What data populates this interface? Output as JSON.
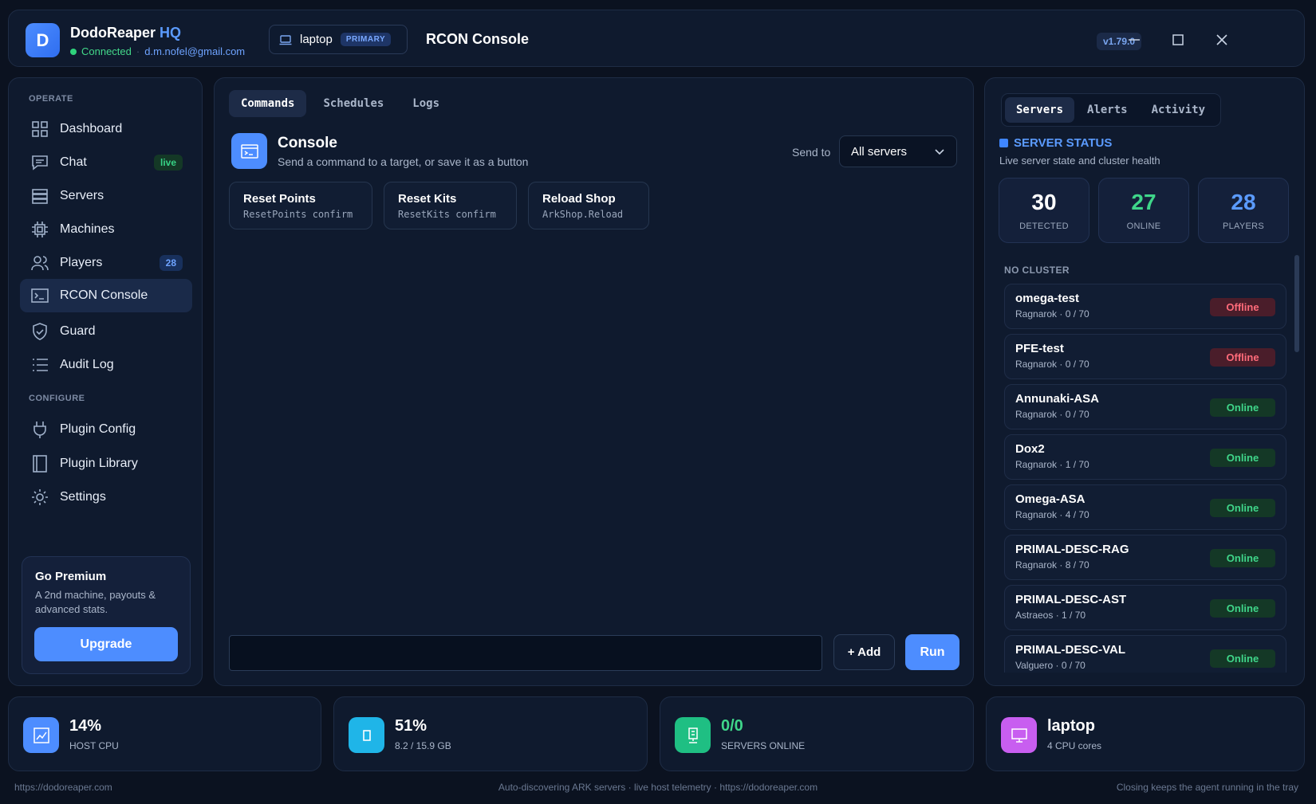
{
  "app": {
    "logo_letter": "D",
    "name": "DodoReaper",
    "name_suffix": "HQ",
    "status": "Connected",
    "email": "d.m.nofel@gmail.com",
    "machine": "laptop",
    "machine_badge": "PRIMARY",
    "page_title": "RCON Console",
    "version": "v1.79.0"
  },
  "colors": {
    "accent": "#4d8dff",
    "online": "#3fd68a",
    "offline": "#ff6b7a",
    "background": "#0b1220"
  },
  "sidebar": {
    "operate_label": "OPERATE",
    "configure_label": "CONFIGURE",
    "items": [
      {
        "label": "Dashboard",
        "icon": "grid-icon"
      },
      {
        "label": "Chat",
        "icon": "chat-icon",
        "badge": "live"
      },
      {
        "label": "Servers",
        "icon": "server-icon"
      },
      {
        "label": "Machines",
        "icon": "cpu-icon"
      },
      {
        "label": "Players",
        "icon": "users-icon",
        "badge": "28"
      },
      {
        "label": "RCON Console",
        "icon": "terminal-icon",
        "active": true
      },
      {
        "label": "Guard",
        "icon": "shield-icon"
      },
      {
        "label": "Audit Log",
        "icon": "list-icon"
      },
      {
        "label": "Plugin Config",
        "icon": "plug-icon"
      },
      {
        "label": "Plugin Library",
        "icon": "book-icon"
      },
      {
        "label": "Settings",
        "icon": "gear-icon"
      }
    ],
    "premium": {
      "title": "Go Premium",
      "desc": "A 2nd machine, payouts & advanced stats.",
      "button": "Upgrade"
    }
  },
  "main": {
    "tabs": [
      {
        "label": "Commands",
        "active": true
      },
      {
        "label": "Schedules"
      },
      {
        "label": "Logs"
      }
    ],
    "console_title": "Console",
    "console_sub": "Send a command to a target, or save it as a button",
    "send_to_label": "Send to",
    "send_to_value": "All servers",
    "commands": [
      {
        "name": "Reset Points",
        "cmd": "ResetPoints confirm"
      },
      {
        "name": "Reset Kits",
        "cmd": "ResetKits confirm"
      },
      {
        "name": "Reload Shop",
        "cmd": "ArkShop.Reload"
      }
    ],
    "input_value": "",
    "add_label": "+ Add",
    "run_label": "Run"
  },
  "right": {
    "tabs": [
      {
        "label": "Servers",
        "active": true
      },
      {
        "label": "Alerts"
      },
      {
        "label": "Activity"
      }
    ],
    "title": "SERVER STATUS",
    "subtitle": "Live server state and cluster health",
    "stats": [
      {
        "value": "30",
        "label": "DETECTED",
        "color": "#ffffff"
      },
      {
        "value": "27",
        "label": "ONLINE",
        "color": "#3fd68a"
      },
      {
        "value": "28",
        "label": "PLAYERS",
        "color": "#5b9bff"
      }
    ],
    "cluster_label": "NO CLUSTER",
    "servers": [
      {
        "name": "omega-test",
        "map": "Ragnarok",
        "players": "0 / 70",
        "status": "Offline"
      },
      {
        "name": "PFE-test",
        "map": "Ragnarok",
        "players": "0 / 70",
        "status": "Offline"
      },
      {
        "name": "Annunaki-ASA",
        "map": "Ragnarok",
        "players": "0 / 70",
        "status": "Online"
      },
      {
        "name": "Dox2",
        "map": "Ragnarok",
        "players": "1 / 70",
        "status": "Online"
      },
      {
        "name": "Omega-ASA",
        "map": "Ragnarok",
        "players": "4 / 70",
        "status": "Online"
      },
      {
        "name": "PRIMAL-DESC-RAG",
        "map": "Ragnarok",
        "players": "8 / 70",
        "status": "Online"
      },
      {
        "name": "PRIMAL-DESC-AST",
        "map": "Astraeos",
        "players": "1 / 70",
        "status": "Online"
      },
      {
        "name": "PRIMAL-DESC-VAL",
        "map": "Valguero",
        "players": "0 / 70",
        "status": "Online"
      }
    ]
  },
  "bottom": [
    {
      "value": "14%",
      "label": "HOST CPU",
      "icon": "chart-icon",
      "icon_bg": "#4d8dff"
    },
    {
      "value": "51%",
      "label": "8.2 / 15.9 GB",
      "icon": "memory-icon",
      "icon_bg": "#1fb5e8"
    },
    {
      "value": "0/0",
      "label": "SERVERS ONLINE",
      "icon": "server-rack-icon",
      "icon_bg": "#1fbf83",
      "value_color": "#3fd68a"
    },
    {
      "value": "laptop",
      "label": "4 CPU cores",
      "icon": "monitor-icon",
      "icon_bg": "#c85ef0"
    }
  ],
  "footer": {
    "left": "https://dodoreaper.com",
    "center": "Auto-discovering ARK servers · live host telemetry · https://dodoreaper.com",
    "right": "Closing keeps the agent running in the tray"
  }
}
